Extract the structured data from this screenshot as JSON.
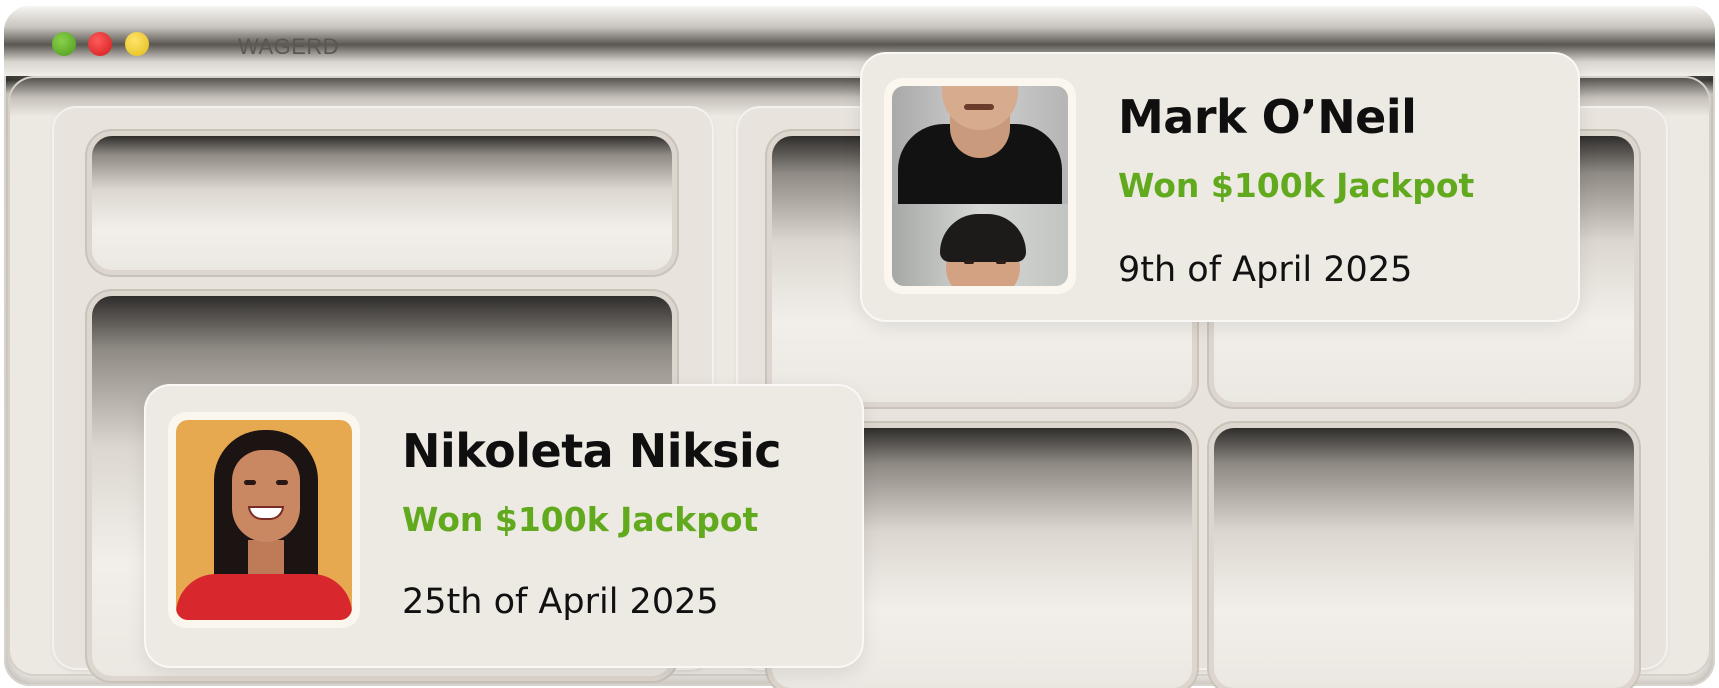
{
  "window": {
    "title": "WAGERD",
    "traffic_lights": [
      "green",
      "red",
      "yellow"
    ]
  },
  "winners": [
    {
      "name": "Mark O’Neil",
      "status": "Won $100k Jackpot",
      "date": "9th of April 2025",
      "avatar": "man-portrait"
    },
    {
      "name": "Nikoleta Niksic",
      "status": "Won $100k Jackpot",
      "date": "25th of April 2025",
      "avatar": "woman-portrait"
    }
  ],
  "colors": {
    "status_green": "#62aa1d",
    "dot_green": "#5aa627",
    "dot_red": "#e5322f",
    "dot_yellow": "#f2ce3a",
    "card_bg": "#ede9e3"
  }
}
